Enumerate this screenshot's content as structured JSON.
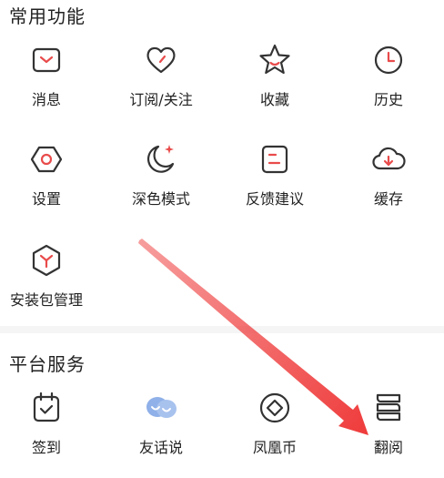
{
  "sections": {
    "common": {
      "title": "常用功能",
      "items": [
        {
          "label": "消息",
          "icon": "mail-icon"
        },
        {
          "label": "订阅/关注",
          "icon": "heart-icon"
        },
        {
          "label": "收藏",
          "icon": "star-icon"
        },
        {
          "label": "历史",
          "icon": "clock-icon"
        },
        {
          "label": "设置",
          "icon": "hexagon-settings-icon"
        },
        {
          "label": "深色模式",
          "icon": "moon-icon"
        },
        {
          "label": "反馈建议",
          "icon": "feedback-icon"
        },
        {
          "label": "缓存",
          "icon": "cloud-download-icon"
        },
        {
          "label": "安装包管理",
          "icon": "package-icon"
        }
      ]
    },
    "platform": {
      "title": "平台服务",
      "items": [
        {
          "label": "签到",
          "icon": "checkin-calendar-icon"
        },
        {
          "label": "友话说",
          "icon": "chat-bubbles-icon"
        },
        {
          "label": "凤凰币",
          "icon": "coin-icon"
        },
        {
          "label": "翻阅",
          "icon": "book-stack-icon"
        }
      ]
    }
  },
  "colors": {
    "accent": "#e94b4b",
    "icon_stroke": "#333333",
    "chat_blue": "#8fb0e8",
    "arrow": "#ef3b3b"
  }
}
